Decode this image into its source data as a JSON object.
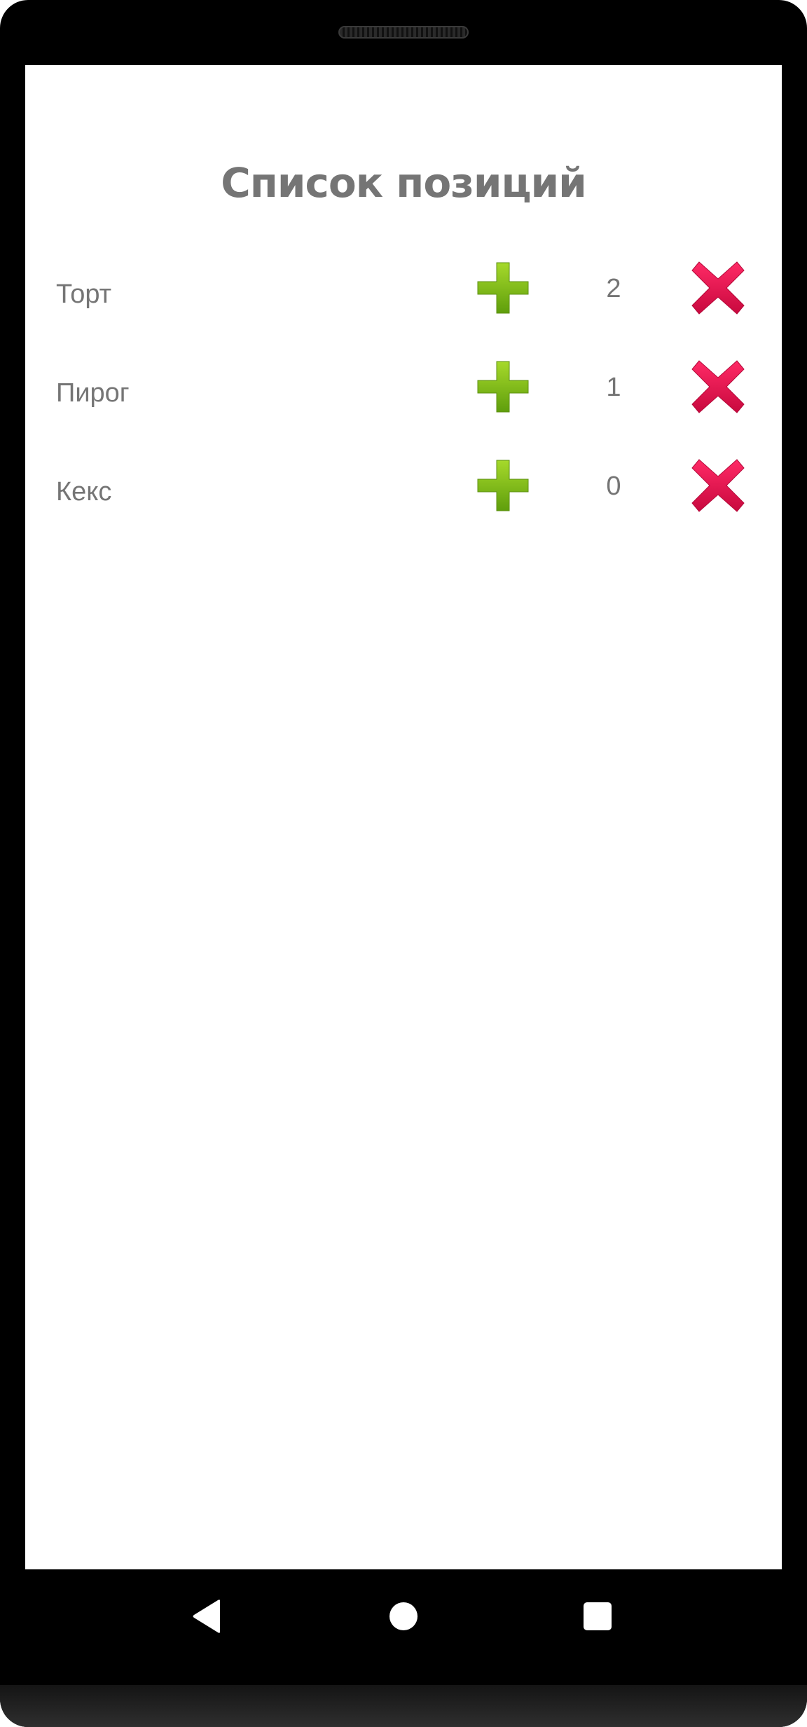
{
  "screen": {
    "title": "Список позиций"
  },
  "items": [
    {
      "name": "Торт",
      "count": "2"
    },
    {
      "name": "Пирог",
      "count": "1"
    },
    {
      "name": "Кекс",
      "count": "0"
    }
  ],
  "icons": {
    "add": "plus-icon",
    "delete": "close-icon",
    "nav_back": "back-icon",
    "nav_home": "home-icon",
    "nav_recents": "recents-icon"
  },
  "colors": {
    "text": "#757575",
    "add_green": "#7cb518",
    "delete_red": "#e0124f",
    "nav_bar": "#000000"
  }
}
